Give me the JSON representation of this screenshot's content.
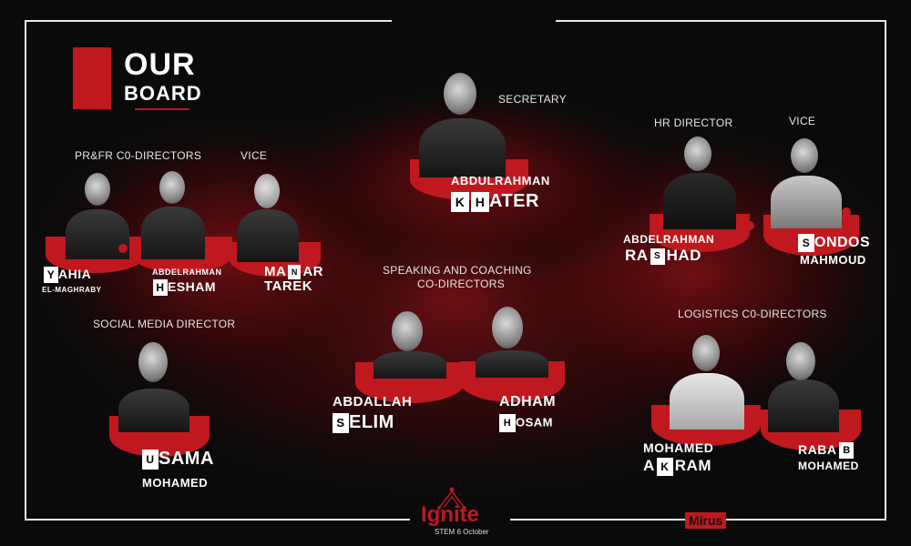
{
  "colors": {
    "accent": "#c0181f",
    "background": "#0a0a0a",
    "frame": "#e8e8e8"
  },
  "title": {
    "line1": "OUR",
    "line2": "BOARD"
  },
  "roles": {
    "prfr": "PR&FR C0-DIRECTORS",
    "vice_left": "VICE",
    "secretary": "SECRETARY",
    "hr": "HR DIRECTOR",
    "vice_right": "VICE",
    "speaking_line1": "SPEAKING AND COACHING",
    "speaking_line2": "CO-DIRECTORS",
    "social": "SOCIAL MEDIA DIRECTOR",
    "logistics": "LOGISTICS C0-DIRECTORS"
  },
  "members": {
    "yahia": {
      "box": "Y",
      "rest": "AHIA",
      "line2": "EL-MAGHRABY"
    },
    "hesham": {
      "line1": "ABDELRAHMAN",
      "box": "H",
      "rest": "ESHAM"
    },
    "manar": {
      "pre": "MA",
      "box": "N",
      "rest": "AR",
      "line2": "TAREK"
    },
    "khater": {
      "line1": "ABDULRAHMAN",
      "box1": "K",
      "box2": "H",
      "rest": "ATER"
    },
    "rashad": {
      "line1": "ABDELRAHMAN",
      "pre": "RA",
      "box": "S",
      "rest": "HAD"
    },
    "sondos": {
      "box": "S",
      "rest": "ONDOS",
      "line2": "MAHMOUD"
    },
    "selim": {
      "line1": "ABDALLAH",
      "box": "S",
      "rest": "ELIM"
    },
    "hosam": {
      "line1": "ADHAM",
      "box": "H",
      "rest": "OSAM"
    },
    "osama": {
      "box": "U",
      "rest": "SAMA",
      "line2": "MOHAMED"
    },
    "akram": {
      "line1": "MOHAMED",
      "pre": "A",
      "box": "K",
      "rest": "RAM"
    },
    "rabab": {
      "pre": "RABA",
      "box": "B",
      "line2": "MOHAMED"
    }
  },
  "footer": {
    "logo": "Ignite",
    "logo_sub": "STEM 6 October",
    "sponsor": "Mirus"
  }
}
